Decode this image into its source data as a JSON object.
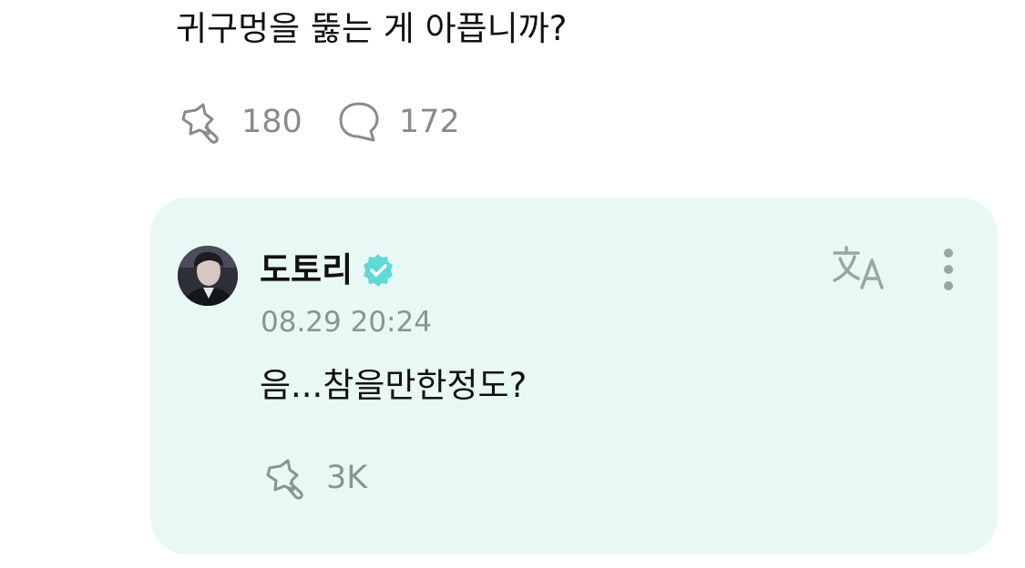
{
  "post": {
    "text": "귀구멍을 뚫는 게 아픕니까?",
    "like_count": "180",
    "comment_count": "172"
  },
  "reply": {
    "author": "도토리",
    "timestamp": "08.29 20:24",
    "text": "음...참을만한정도?",
    "like_count": "3K"
  },
  "icons": {
    "like": "star-like-icon",
    "comment": "speech-bubble-icon",
    "verified": "verified-badge-icon",
    "translate": "translate-icon",
    "more": "more-vertical-icon"
  },
  "colors": {
    "card_background": "#e8f8f5",
    "verified": "#5fd9d6",
    "muted_text": "#8a8a8a",
    "icon_muted": "#9aa6a4"
  }
}
